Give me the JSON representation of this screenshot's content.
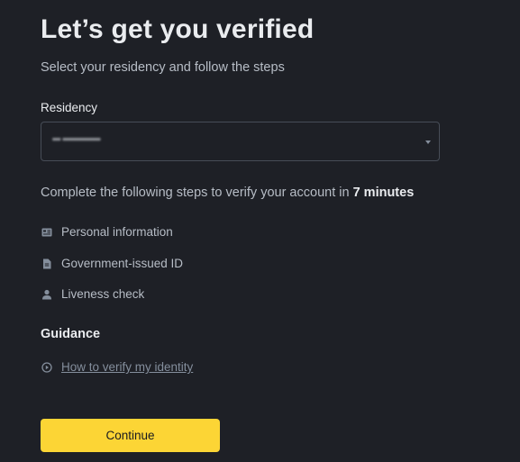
{
  "header": {
    "title": "Let’s get you verified",
    "subtitle": "Select your residency and follow the steps"
  },
  "residency": {
    "label": "Residency",
    "value": "••• ••••••••••••••",
    "caret_icon": "chevron-down-icon"
  },
  "steps": {
    "intro_prefix": "Complete the following steps to verify your account in ",
    "intro_time": "7 minutes",
    "items": [
      {
        "label": "Personal information",
        "icon": "id-card-icon"
      },
      {
        "label": "Government-issued ID",
        "icon": "document-icon"
      },
      {
        "label": "Liveness check",
        "icon": "person-icon"
      }
    ]
  },
  "guidance": {
    "heading": "Guidance",
    "link_label": "How to verify my identity",
    "link_icon": "play-circle-icon"
  },
  "actions": {
    "continue_label": "Continue"
  },
  "colors": {
    "background": "#1e2026",
    "primary_text": "#eaecef",
    "secondary_text": "#b7bdc6",
    "muted_text": "#848e9c",
    "border": "#474d57",
    "accent": "#fcd535"
  }
}
